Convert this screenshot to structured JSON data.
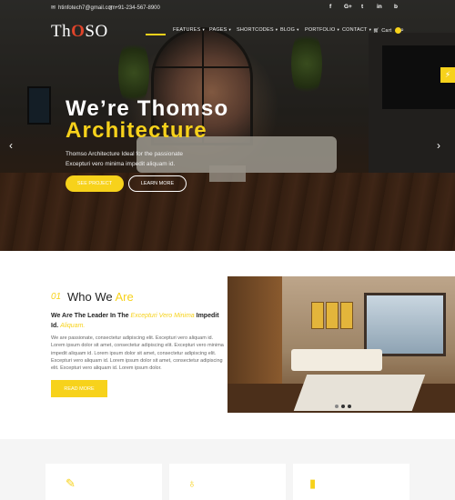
{
  "topbar": {
    "email": "htinfotech7@gmail.com",
    "phone": "+91-234-567-8900",
    "social": [
      "f",
      "G+",
      "t",
      "in",
      "b"
    ]
  },
  "logo": {
    "pre": "Th",
    "mark": "O",
    "post": "SO"
  },
  "nav": {
    "items": [
      {
        "label": "FEATURES",
        "caret": "▾"
      },
      {
        "label": "PAGES",
        "caret": "▾"
      },
      {
        "label": "SHORTCODES",
        "caret": "▾"
      },
      {
        "label": "BLOG",
        "caret": "▾"
      },
      {
        "label": "PORTFOLIO",
        "caret": "▾"
      },
      {
        "label": "CONTACT",
        "caret": "▾"
      }
    ],
    "cart_label": "Cart",
    "cart_count": "0"
  },
  "hero": {
    "line1": "We’re Thomso",
    "line2": "Architecture",
    "sub1": "Thomso Architecture Ideal for the passionate",
    "sub2": "Excepturi vero minima impedit aliquam id.",
    "btn_primary": "SEE PROJECT",
    "btn_secondary": "LEARN MORE",
    "prev": "‹",
    "next": "›"
  },
  "who": {
    "num": "01",
    "title_a": "Who We",
    "title_b": "Are",
    "lead_a": "We Are The Leader In The",
    "lead_b": "Excepturi Vero Minima",
    "lead_c": "Impedit Id.",
    "lead_d": "Aliquam.",
    "body": "We are passionate, consectetur adipiscing elit. Excepturi vero aliquam id. Lorem ipsum dolor sit amet, consectetur adipiscing elit. Excepturi vero minima impedit aliquam id. Lorem ipsum dolor sit amet, consectetur adipiscing elit. Excepturi vero aliquam id. Lorem ipsum dolor sit amet, consectetur adipiscing elit. Excepturi vero aliquam id. Lorem ipsum dolor.",
    "button": "READ MORE"
  },
  "services": {
    "icons": [
      "pencil-ruler-icon",
      "lightbulb-icon",
      "paint-roller-icon"
    ]
  },
  "colors": {
    "accent": "#f7d21b",
    "logo_mark": "#e0442a"
  }
}
